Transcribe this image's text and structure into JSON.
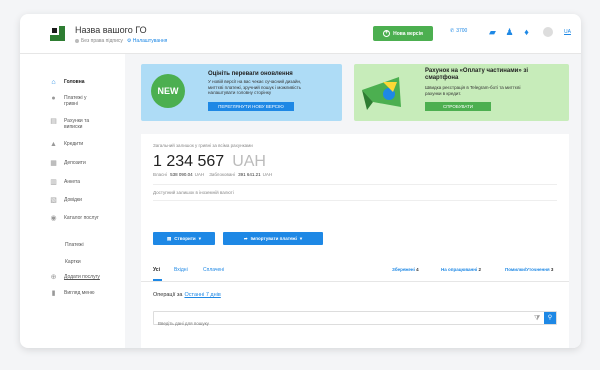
{
  "header": {
    "company_name": "Назва вашого ГО",
    "signature_status": "Без права підпису",
    "settings_link": "Налаштування",
    "new_version_button": "Нова версія",
    "phone": "3700",
    "lang": "UA"
  },
  "sidebar": {
    "items": [
      {
        "label": "Головна"
      },
      {
        "label": "Платежі у гривні"
      },
      {
        "label": "Рахунки та виписки"
      },
      {
        "label": "Кредити"
      },
      {
        "label": "Депозити"
      },
      {
        "label": "Анкета"
      },
      {
        "label": "Довідки"
      },
      {
        "label": "Каталог послуг"
      }
    ],
    "sub": [
      {
        "label": "Платежі"
      },
      {
        "label": "Картки"
      },
      {
        "label": "Додати послугу"
      },
      {
        "label": "Вигляд меню"
      }
    ]
  },
  "banners": [
    {
      "badge": "NEW",
      "title": "Оцініть переваги оновлення",
      "text": [
        "У новій версії на вас чекає сучасний дизайн,",
        "миттєві платежі, зручний пошук і можливість",
        "налаштувати головну сторінку"
      ],
      "button": "ПЕРЕГЛЯНУТИ НОВУ ВЕРСІЮ"
    },
    {
      "title": [
        "Рахунок на «Оплату частинами» зі",
        "смартфона"
      ],
      "text": [
        "Швидка реєстрація в Telegram-боті та миттєві",
        "рахунки в кредит."
      ],
      "button": "СПРОБУВАТИ"
    }
  ],
  "balance": {
    "label": "Загальний залишок у гривні за всіма рахунками",
    "amount": "1 234 567",
    "currency": "UAH",
    "own_label": "Власні",
    "own_value": "538 090.04",
    "own_cur": "UAH",
    "blocked_label": "Заблоковані",
    "blocked_value": "391 641.21",
    "blocked_cur": "UAH",
    "fx_note": "Доступний залишок в іноземній валюті"
  },
  "actions": {
    "create": "Створити",
    "import": "Імпортувати платежі"
  },
  "tabs": {
    "all": "Усі",
    "incoming": "Вхідні",
    "paid": "Сплачені",
    "saved": "Збережені",
    "saved_count": "4",
    "processing": "На опрацюванні",
    "processing_count": "2",
    "errors": "Помилки/Уточнення",
    "errors_count": "3"
  },
  "operations": {
    "label": "Операції за",
    "period": "Останні 7 днів",
    "search_placeholder": "Введіть дані для пошуку"
  },
  "colors": {
    "accent": "#1e88e5",
    "green": "#4caf50",
    "banner_blue": "#aedcf6",
    "banner_green": "#c7ecba"
  }
}
